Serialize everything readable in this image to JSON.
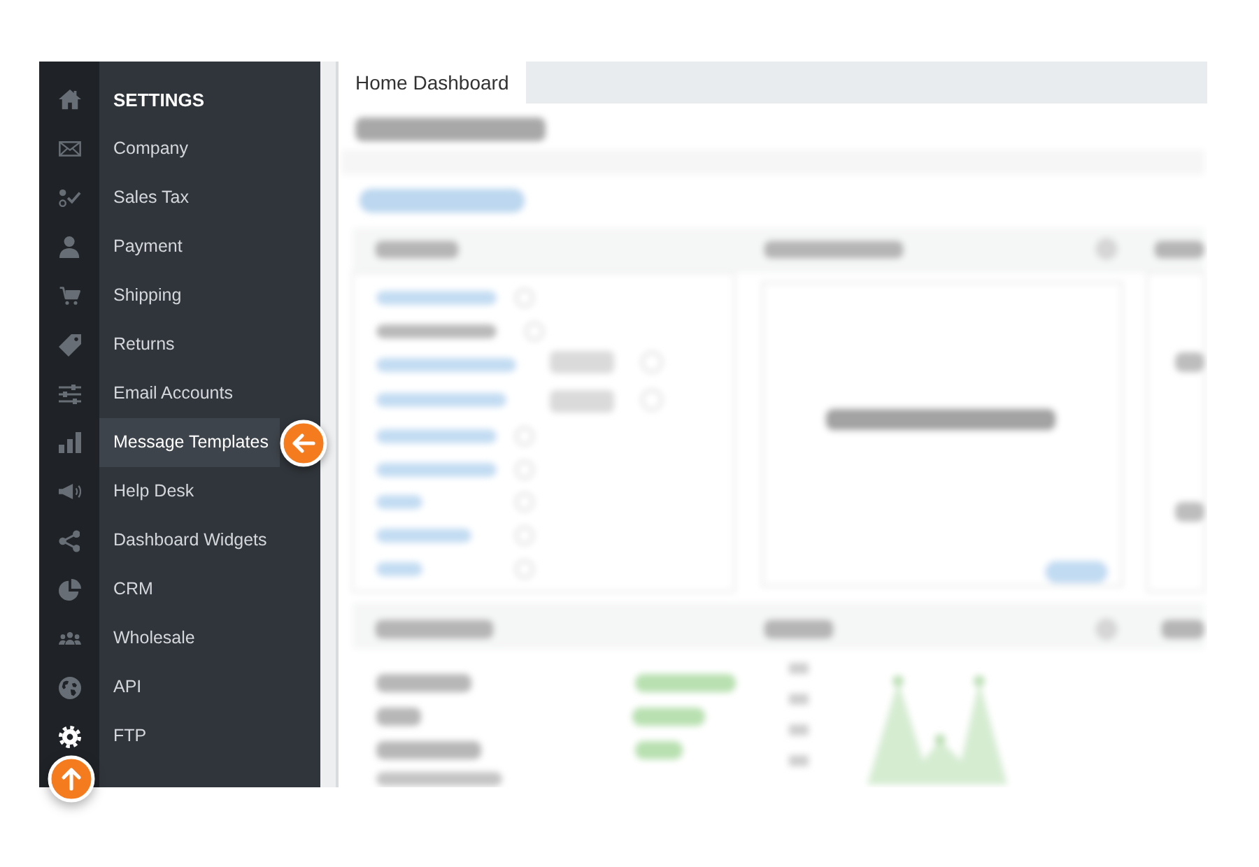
{
  "rail": {
    "items": [
      {
        "selected": false
      },
      {
        "selected": false
      },
      {
        "selected": false
      },
      {
        "selected": false
      },
      {
        "selected": false
      },
      {
        "selected": false
      },
      {
        "selected": false
      },
      {
        "selected": false
      },
      {
        "selected": false
      },
      {
        "selected": false
      },
      {
        "selected": false
      },
      {
        "selected": false
      },
      {
        "selected": false
      },
      {
        "selected": true
      }
    ],
    "callout": true
  },
  "sidebar": {
    "title": "SETTINGS",
    "items": [
      {
        "label": "Company",
        "selected": false,
        "callout": false
      },
      {
        "label": "Sales Tax",
        "selected": false,
        "callout": false
      },
      {
        "label": "Payment",
        "selected": false,
        "callout": false
      },
      {
        "label": "Shipping",
        "selected": false,
        "callout": false
      },
      {
        "label": "Returns",
        "selected": false,
        "callout": false
      },
      {
        "label": "Email Accounts",
        "selected": false,
        "callout": false
      },
      {
        "label": "Message Templates",
        "selected": true,
        "callout": true
      },
      {
        "label": "Help Desk",
        "selected": false,
        "callout": false
      },
      {
        "label": "Dashboard Widgets",
        "selected": false,
        "callout": false
      },
      {
        "label": "CRM",
        "selected": false,
        "callout": false
      },
      {
        "label": "Wholesale",
        "selected": false,
        "callout": false
      },
      {
        "label": "API",
        "selected": false,
        "callout": false
      },
      {
        "label": "FTP",
        "selected": false,
        "callout": false
      }
    ]
  },
  "tabs": [
    {
      "label": "Home Dashboard",
      "selected": true
    }
  ]
}
